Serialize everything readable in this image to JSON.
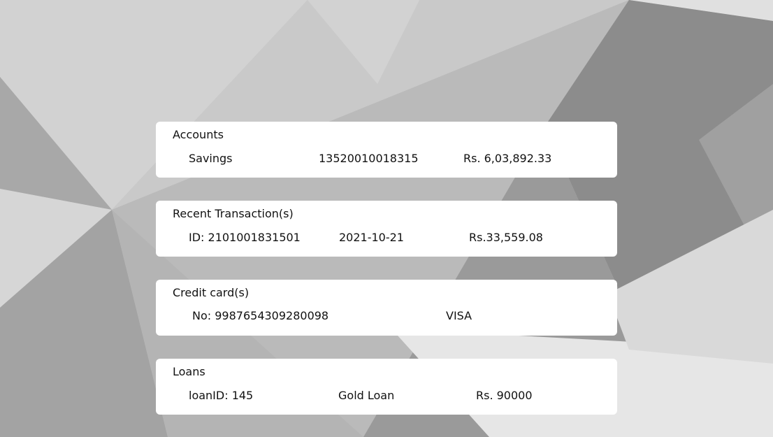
{
  "background": {
    "description_colors": [
      "#cfcfcf",
      "#a9a9a9",
      "#8e8e8e",
      "#e2e2e2",
      "#b8b8b8"
    ]
  },
  "accounts": {
    "title": "Accounts",
    "type": "Savings",
    "number": "13520010018315",
    "balance": "Rs. 6,03,892.33"
  },
  "transactions": {
    "title": "Recent Transaction(s)",
    "id": "ID: 2101001831501",
    "date": "2021-10-21",
    "amount": "Rs.33,559.08"
  },
  "credit_cards": {
    "title": "Credit card(s)",
    "number": "No: 9987654309280098",
    "network": "VISA"
  },
  "loans": {
    "title": "Loans",
    "id": "loanID: 145",
    "type": "Gold Loan",
    "amount": "Rs. 90000"
  }
}
